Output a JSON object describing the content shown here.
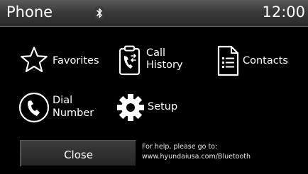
{
  "header": {
    "title": "Phone",
    "status_icon": "bluetooth-icon",
    "clock": "12:00"
  },
  "menu": [
    {
      "id": "favorites",
      "icon": "star-icon",
      "label_line1": "Favorites",
      "label_line2": ""
    },
    {
      "id": "call-history",
      "icon": "call-history-icon",
      "label_line1": "Call",
      "label_line2": "History"
    },
    {
      "id": "contacts",
      "icon": "contacts-book-icon",
      "label_line1": "Contacts",
      "label_line2": ""
    },
    {
      "id": "dial-number",
      "icon": "handset-icon",
      "label_line1": "Dial",
      "label_line2": "Number"
    },
    {
      "id": "setup",
      "icon": "gear-icon",
      "label_line1": "Setup",
      "label_line2": ""
    }
  ],
  "footer": {
    "close_label": "Close",
    "help_line1": "For help, please go to:",
    "help_line2": "www.hyundaiusa.com/Bluetooth"
  },
  "colors": {
    "background": "#000000",
    "text": "#ffffff",
    "header_top": "#5a5a5a",
    "header_bottom": "#2a2a2a"
  }
}
